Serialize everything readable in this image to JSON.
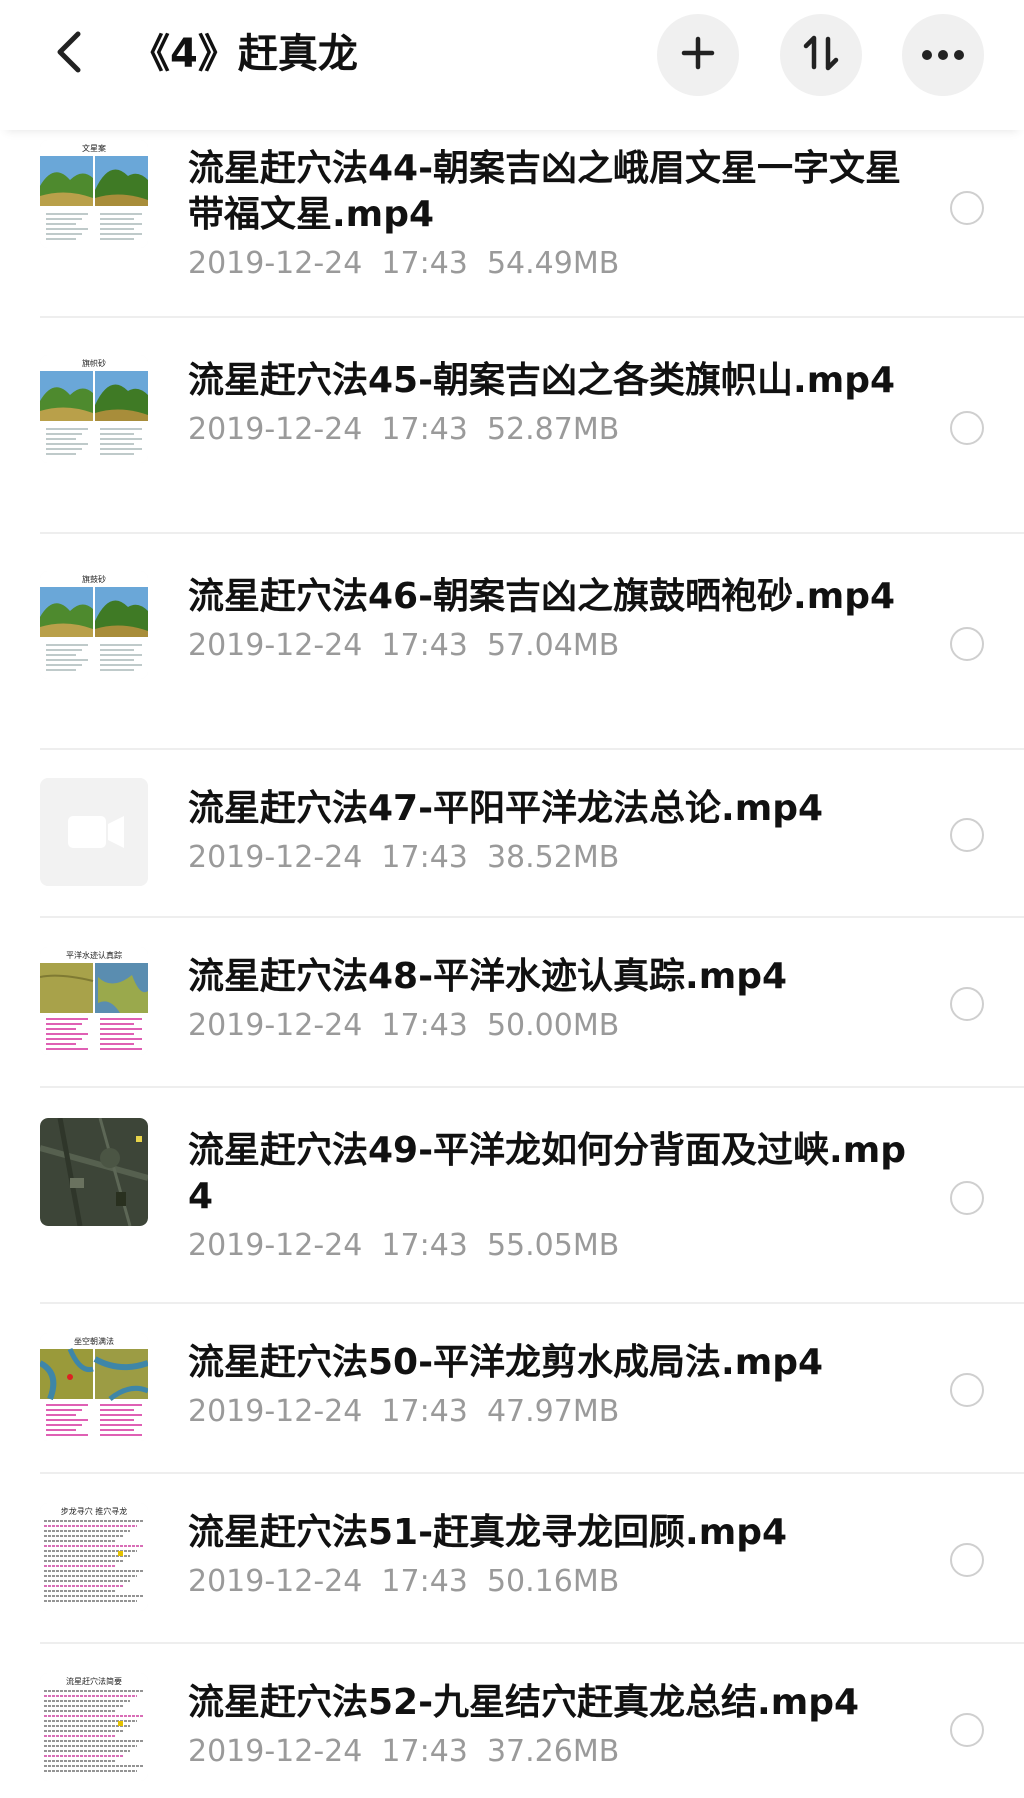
{
  "header": {
    "title": "《4》赶真龙",
    "back_icon": "chevron-left-icon",
    "actions": [
      {
        "name": "add",
        "icon": "plus-icon"
      },
      {
        "name": "sort",
        "icon": "sort-icon"
      },
      {
        "name": "more",
        "icon": "more-horizontal-icon"
      }
    ]
  },
  "files": [
    {
      "name": "流星赶穴法44-朝案吉凶之峨眉文星一字文星带福文星.mp4",
      "date": "2019-12-24  17:43",
      "size": "54.49MB",
      "thumb": "landscape",
      "thumb_caption": "文星案"
    },
    {
      "name": "流星赶穴法45-朝案吉凶之各类旗帜山.mp4",
      "date": "2019-12-24  17:43",
      "size": "52.87MB",
      "thumb": "landscape",
      "thumb_caption": "旗帜砂"
    },
    {
      "name": "流星赶穴法46-朝案吉凶之旗鼓晒袍砂.mp4",
      "date": "2019-12-24  17:43",
      "size": "57.04MB",
      "thumb": "landscape",
      "thumb_caption": "旗鼓砂"
    },
    {
      "name": "流星赶穴法47-平阳平洋龙法总论.mp4",
      "date": "2019-12-24  17:43",
      "size": "38.52MB",
      "thumb": "video-placeholder"
    },
    {
      "name": "流星赶穴法48-平洋水迹认真踪.mp4",
      "date": "2019-12-24  17:43",
      "size": "50.00MB",
      "thumb": "plain-water",
      "thumb_caption": "平洋水迹认真踪"
    },
    {
      "name": "流星赶穴法49-平洋龙如何分背面及过峡.mp4",
      "date": "2019-12-24  17:43",
      "size": "55.05MB",
      "thumb": "satellite"
    },
    {
      "name": "流星赶穴法50-平洋龙剪水成局法.mp4",
      "date": "2019-12-24  17:43",
      "size": "47.97MB",
      "thumb": "river",
      "thumb_caption": "坐空朝满法"
    },
    {
      "name": "流星赶穴法51-赶真龙寻龙回顾.mp4",
      "date": "2019-12-24  17:43",
      "size": "50.16MB",
      "thumb": "text-doc",
      "thumb_caption": "步龙寻穴 推穴寻龙"
    },
    {
      "name": "流星赶穴法52-九星结穴赶真龙总结.mp4",
      "date": "2019-12-24  17:43",
      "size": "37.26MB",
      "thumb": "text-doc",
      "thumb_caption": "流星赶穴法简要"
    }
  ],
  "colors": {
    "secondary_text": "#9a9a9a",
    "divider": "#eeeeee",
    "icon_button_bg": "#f0f0f0"
  }
}
